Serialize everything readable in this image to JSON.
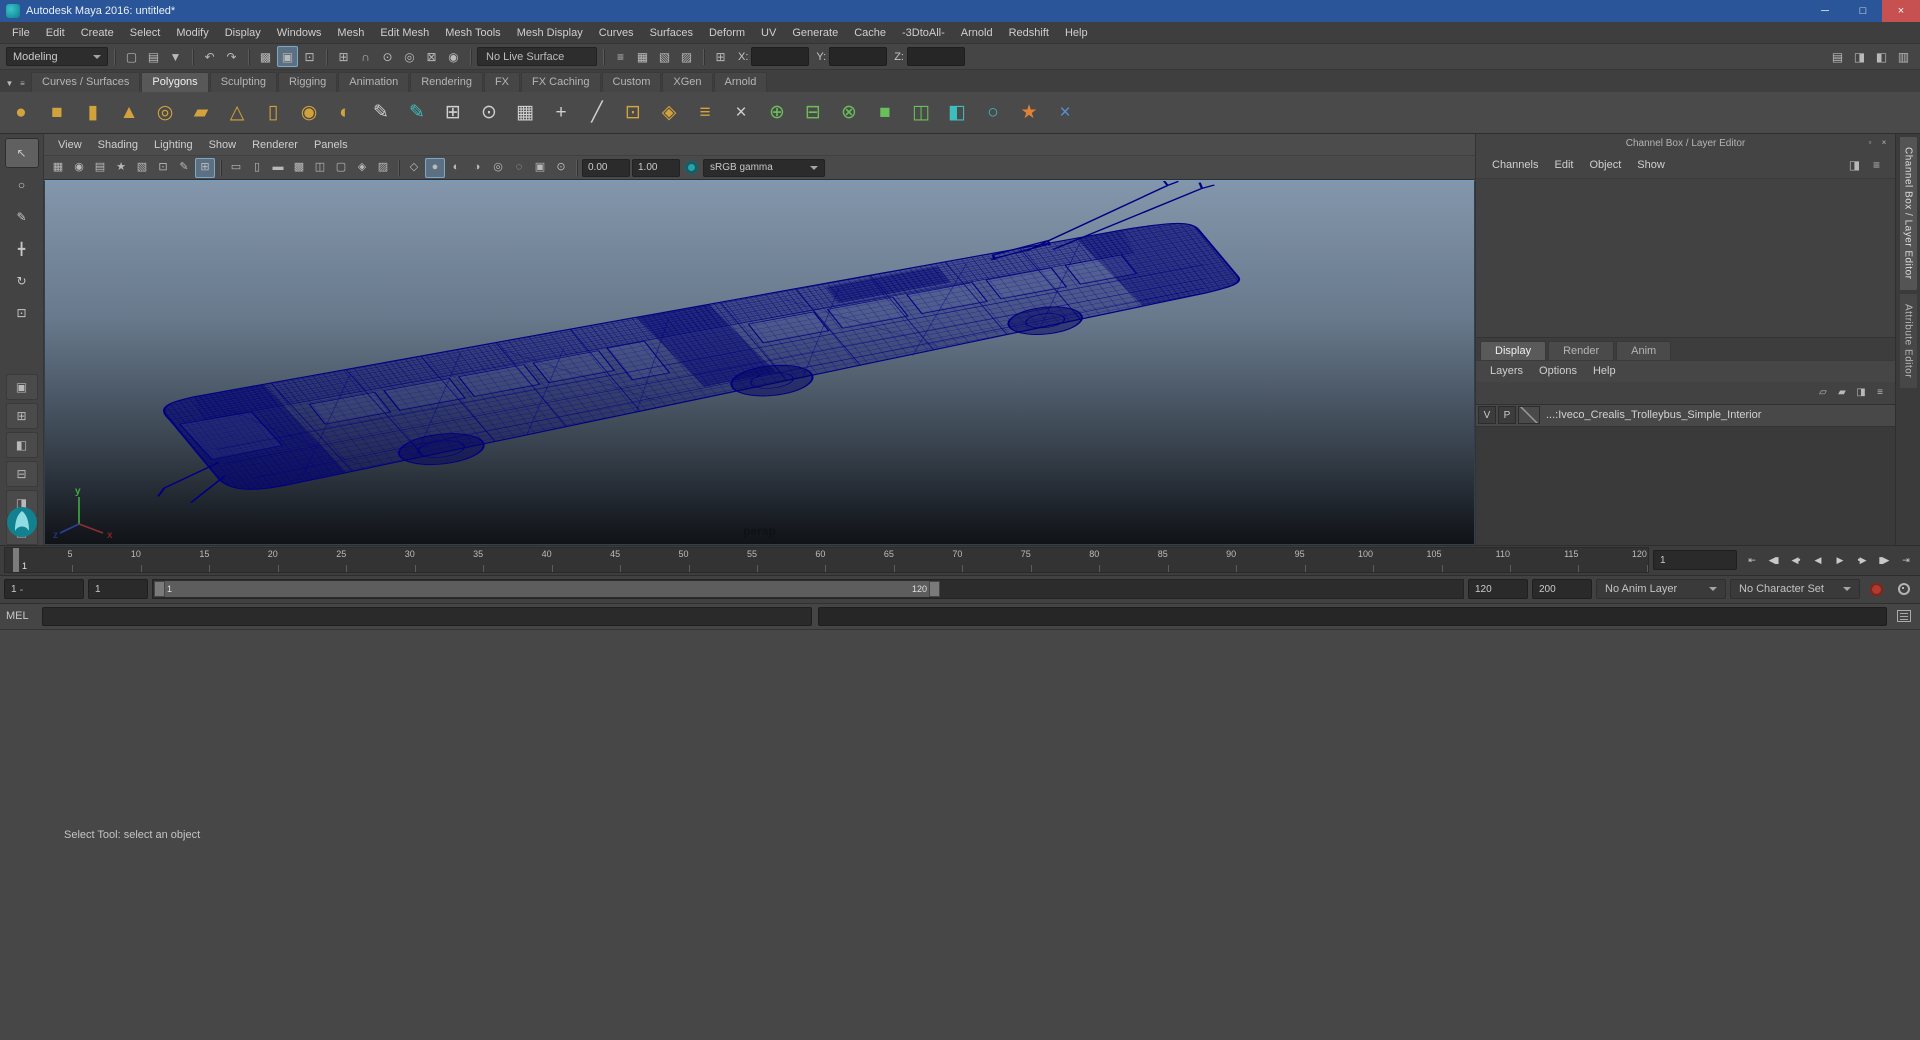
{
  "colors": {
    "titlebar": "#2a5699",
    "close_button": "#c75050",
    "wireframe": "#000082",
    "viewport_top": "#8496ab",
    "viewport_bottom": "#101317",
    "autokey": "#b03a2e"
  },
  "titlebar": {
    "app_title": "Autodesk Maya 2016: untitled*",
    "minimize_glyph": "─",
    "maximize_glyph": "□",
    "close_glyph": "×"
  },
  "menubar": [
    "File",
    "Edit",
    "Create",
    "Select",
    "Modify",
    "Display",
    "Windows",
    "Mesh",
    "Edit Mesh",
    "Mesh Tools",
    "Mesh Display",
    "Curves",
    "Surfaces",
    "Deform",
    "UV",
    "Generate",
    "Cache",
    "-3DtoAll-",
    "Arnold",
    "Redshift",
    "Help"
  ],
  "statusline": {
    "workspace": "Modeling",
    "file_icons": [
      {
        "name": "new-scene-icon",
        "glyph": "▢"
      },
      {
        "name": "open-scene-icon",
        "glyph": "▤"
      },
      {
        "name": "save-scene-icon",
        "glyph": "▼"
      }
    ],
    "undo_icons": [
      {
        "name": "undo-icon",
        "glyph": "↶"
      },
      {
        "name": "redo-icon",
        "glyph": "↷"
      }
    ],
    "selection_icons": [
      {
        "name": "select-hierarchy-icon",
        "glyph": "▩"
      },
      {
        "name": "select-object-icon",
        "glyph": "▣",
        "active": true
      },
      {
        "name": "select-component-icon",
        "glyph": "⊡"
      }
    ],
    "snap_icons": [
      {
        "name": "snap-to-grid-icon",
        "glyph": "⊞"
      },
      {
        "name": "snap-to-curve-icon",
        "glyph": "∩"
      },
      {
        "name": "snap-to-point-icon",
        "glyph": "⊙"
      },
      {
        "name": "snap-to-projected-center-icon",
        "glyph": "◎"
      },
      {
        "name": "snap-to-view-plane-icon",
        "glyph": "⊠"
      },
      {
        "name": "make-live-icon",
        "glyph": "◉"
      }
    ],
    "live_surface": "No Live Surface",
    "render_icons": [
      {
        "name": "construction-history-icon",
        "glyph": "≡"
      },
      {
        "name": "render-current-frame-icon",
        "glyph": "▦"
      },
      {
        "name": "ipr-render-icon",
        "glyph": "▧"
      },
      {
        "name": "render-settings-icon",
        "glyph": "▨"
      }
    ],
    "coords": {
      "selector_glyph": "⊞",
      "x_label": "X:",
      "y_label": "Y:",
      "z_label": "Z:",
      "x_value": "",
      "y_value": "",
      "z_value": ""
    },
    "right_icons": [
      {
        "name": "modeling-toolkit-toggle-icon",
        "glyph": "▤"
      },
      {
        "name": "attribute-editor-toggle-icon",
        "glyph": "◨"
      },
      {
        "name": "tool-settings-toggle-icon",
        "glyph": "◧"
      },
      {
        "name": "channel-box-toggle-icon",
        "glyph": "▥"
      }
    ]
  },
  "shelf": {
    "menu_icons": [
      {
        "name": "shelf-tab-menu-icon",
        "glyph": "▼"
      },
      {
        "name": "shelf-options-icon",
        "glyph": "≡"
      }
    ],
    "tabs": [
      {
        "label": "Curves / Surfaces"
      },
      {
        "label": "Polygons",
        "active": true
      },
      {
        "label": "Sculpting"
      },
      {
        "label": "Rigging"
      },
      {
        "label": "Animation"
      },
      {
        "label": "Rendering"
      },
      {
        "label": "FX"
      },
      {
        "label": "FX Caching"
      },
      {
        "label": "Custom"
      },
      {
        "label": "XGen"
      },
      {
        "label": "Arnold"
      }
    ],
    "items": [
      {
        "name": "poly-sphere",
        "glyph": "●",
        "color": "#d2a23c"
      },
      {
        "name": "poly-cube",
        "glyph": "■",
        "color": "#d2a23c"
      },
      {
        "name": "poly-cylinder",
        "glyph": "▮",
        "color": "#d2a23c"
      },
      {
        "name": "poly-cone",
        "glyph": "▲",
        "color": "#d2a23c"
      },
      {
        "name": "poly-torus",
        "glyph": "◎",
        "color": "#d2a23c"
      },
      {
        "name": "poly-plane",
        "glyph": "▰",
        "color": "#d2a23c"
      },
      {
        "name": "poly-pyramid",
        "glyph": "△",
        "color": "#d2a23c"
      },
      {
        "name": "poly-pipe",
        "glyph": "▯",
        "color": "#d2a23c"
      },
      {
        "name": "smooth-mesh-display",
        "glyph": "◉",
        "color": "#d2a23c"
      },
      {
        "name": "subdiv-proxy",
        "glyph": "◐",
        "color": "#d2a23c"
      },
      {
        "name": "sculpt-tool",
        "glyph": "✎",
        "color": "#d0d0d0"
      },
      {
        "name": "quad-draw-tool",
        "glyph": "✎",
        "color": "#3fbdbd"
      },
      {
        "name": "quadrangulate",
        "glyph": "⊞",
        "color": "#d0d0d0"
      },
      {
        "name": "spherical-map",
        "glyph": "⊙",
        "color": "#d0d0d0"
      },
      {
        "name": "add-divisions",
        "glyph": "▦",
        "color": "#d0d0d0"
      },
      {
        "name": "append-polygon-tool",
        "glyph": "+",
        "color": "#d0d0d0"
      },
      {
        "name": "multi-cut-tool",
        "glyph": "╱",
        "color": "#d0d0d0"
      },
      {
        "name": "extrude",
        "glyph": "⊡",
        "color": "#d2a23c"
      },
      {
        "name": "bevel",
        "glyph": "◈",
        "color": "#d2a23c"
      },
      {
        "name": "bridge",
        "glyph": "≡",
        "color": "#d2a23c"
      },
      {
        "name": "delete-edge",
        "glyph": "×",
        "color": "#d0d0d0"
      },
      {
        "name": "boolean-union",
        "glyph": "⊕",
        "color": "#69bf59"
      },
      {
        "name": "boolean-difference",
        "glyph": "⊟",
        "color": "#69bf59"
      },
      {
        "name": "boolean-intersection",
        "glyph": "⊗",
        "color": "#69bf59"
      },
      {
        "name": "combine",
        "glyph": "■",
        "color": "#69bf59"
      },
      {
        "name": "separate",
        "glyph": "◫",
        "color": "#69bf59"
      },
      {
        "name": "mirror-geometry",
        "glyph": "◧",
        "color": "#3fbdbd"
      },
      {
        "name": "smooth",
        "glyph": "○",
        "color": "#3fbdbd"
      },
      {
        "name": "platonic-solid",
        "glyph": "★",
        "color": "#e0813a"
      },
      {
        "name": "symmetry-toggle",
        "glyph": "×",
        "color": "#5b8dd6"
      }
    ]
  },
  "toolbox": {
    "tools": [
      {
        "name": "select-tool",
        "glyph": "↖",
        "active": true
      },
      {
        "name": "lasso-select-tool",
        "glyph": "○"
      },
      {
        "name": "paint-select-tool",
        "glyph": "✎"
      },
      {
        "name": "move-tool",
        "glyph": "╋"
      },
      {
        "name": "rotate-tool",
        "glyph": "↻"
      },
      {
        "name": "scale-tool",
        "glyph": "⊡"
      }
    ],
    "layouts": [
      {
        "name": "layout-single-perspective",
        "glyph": "▣"
      },
      {
        "name": "layout-four-view",
        "glyph": "⊞"
      },
      {
        "name": "layout-persp-outliner",
        "glyph": "◧"
      },
      {
        "name": "layout-persp-graph",
        "glyph": "⊟"
      },
      {
        "name": "layout-hypershade-persp",
        "glyph": "◨"
      },
      {
        "name": "layout-persp-uv",
        "glyph": "◫"
      },
      {
        "name": "layout-outliner-persp",
        "glyph": "▥"
      }
    ],
    "collapse_label": "-"
  },
  "viewport": {
    "menus": [
      "View",
      "Shading",
      "Lighting",
      "Show",
      "Renderer",
      "Panels"
    ],
    "toolbar": {
      "icons_a": [
        {
          "name": "select-camera-icon",
          "glyph": "▦"
        },
        {
          "name": "lock-camera-icon",
          "glyph": "◉"
        },
        {
          "name": "camera-attributes-icon",
          "glyph": "▤"
        },
        {
          "name": "bookmarks-icon",
          "glyph": "★"
        },
        {
          "name": "image-plane-icon",
          "glyph": "▧"
        },
        {
          "name": "2d-pan-zoom-icon",
          "glyph": "⊡"
        },
        {
          "name": "grease-pencil-icon",
          "glyph": "✎"
        },
        {
          "name": "grid-icon",
          "glyph": "⊞",
          "active": true
        }
      ],
      "icons_b": [
        {
          "name": "film-gate-icon",
          "glyph": "▭"
        },
        {
          "name": "resolution-gate-icon",
          "glyph": "▯"
        },
        {
          "name": "gate-mask-icon",
          "glyph": "▬"
        },
        {
          "name": "field-chart-icon",
          "glyph": "▩"
        },
        {
          "name": "safe-action-icon",
          "glyph": "◫"
        },
        {
          "name": "safe-title-icon",
          "glyph": "▢"
        },
        {
          "name": "highlight-selection-icon",
          "glyph": "◈"
        },
        {
          "name": "textured-icon",
          "glyph": "▨"
        }
      ],
      "icons_c": [
        {
          "name": "wireframe-icon",
          "glyph": "◇"
        },
        {
          "name": "smooth-shade-icon",
          "glyph": "●",
          "active": true
        },
        {
          "name": "use-all-lights-icon",
          "glyph": "◐"
        },
        {
          "name": "shadows-icon",
          "glyph": "◑"
        },
        {
          "name": "screen-space-ao-icon",
          "glyph": "◎"
        },
        {
          "name": "motion-blur-icon",
          "glyph": "◌"
        },
        {
          "name": "multisample-icon",
          "glyph": "▣"
        },
        {
          "name": "isolate-select-icon",
          "glyph": "⊙"
        }
      ],
      "exposure": "0.00",
      "gamma": "1.00",
      "color_space": "sRGB gamma"
    },
    "camera_label": "persp",
    "axis_labels": {
      "x": "x",
      "y": "y",
      "z": "z"
    }
  },
  "channelbox": {
    "panel_title": "Channel Box / Layer Editor",
    "header_icons": [
      {
        "name": "pin-panel-icon",
        "glyph": "▫"
      },
      {
        "name": "close-panel-icon",
        "glyph": "×"
      }
    ],
    "menus": [
      "Channels",
      "Edit",
      "Object",
      "Show"
    ],
    "menu_icons": [
      {
        "name": "speed-slider-icon",
        "glyph": "◨"
      },
      {
        "name": "channel-settings-icon",
        "glyph": "≡"
      }
    ],
    "layer_editor": {
      "tabs": [
        {
          "label": "Display",
          "active": true
        },
        {
          "label": "Render"
        },
        {
          "label": "Anim"
        }
      ],
      "menus": [
        "Layers",
        "Options",
        "Help"
      ],
      "toolbar_icons": [
        {
          "name": "move-layer-up-icon",
          "glyph": "▱"
        },
        {
          "name": "move-layer-down-icon",
          "glyph": "▰"
        },
        {
          "name": "new-empty-layer-icon",
          "glyph": "◨"
        },
        {
          "name": "new-layer-from-selected-icon",
          "glyph": "≡"
        }
      ],
      "layers": [
        {
          "visibility": "V",
          "playback": "P",
          "name": "...:Iveco_Crealis_Trolleybus_Simple_Interior"
        }
      ]
    },
    "side_tabs": [
      {
        "label": "Channel Box / Layer Editor",
        "active": true
      },
      {
        "label": "Attribute Editor"
      }
    ]
  },
  "timeline": {
    "ticks": [
      "5",
      "10",
      "15",
      "20",
      "25",
      "30",
      "35",
      "40",
      "45",
      "50",
      "55",
      "60",
      "65",
      "70",
      "75",
      "80",
      "85",
      "90",
      "95",
      "100",
      "105",
      "110",
      "115",
      "120"
    ],
    "current_frame_label": "1",
    "current_time": "1",
    "playback_icons": [
      {
        "name": "go-to-start-button",
        "glyph": "⇤"
      },
      {
        "name": "step-back-frame-button",
        "glyph": "◀▮"
      },
      {
        "name": "step-back-key-button",
        "glyph": "◀•"
      },
      {
        "name": "play-backwards-button",
        "glyph": "◀"
      },
      {
        "name": "play-forwards-button",
        "glyph": "▶"
      },
      {
        "name": "step-forward-key-button",
        "glyph": "•▶"
      },
      {
        "name": "step-forward-frame-button",
        "glyph": "▮▶"
      },
      {
        "name": "go-to-end-button",
        "glyph": "⇥"
      }
    ]
  },
  "rangeslider": {
    "animation_start": "1",
    "playback_start": "1",
    "range_start": "1",
    "range_end": "120",
    "playback_end": "120",
    "animation_end": "200",
    "anim_layer": "No Anim Layer",
    "character_set": "No Character Set"
  },
  "commandline": {
    "label": "MEL",
    "input": "",
    "result": ""
  },
  "helpline": {
    "text": "Select Tool: select an object"
  }
}
